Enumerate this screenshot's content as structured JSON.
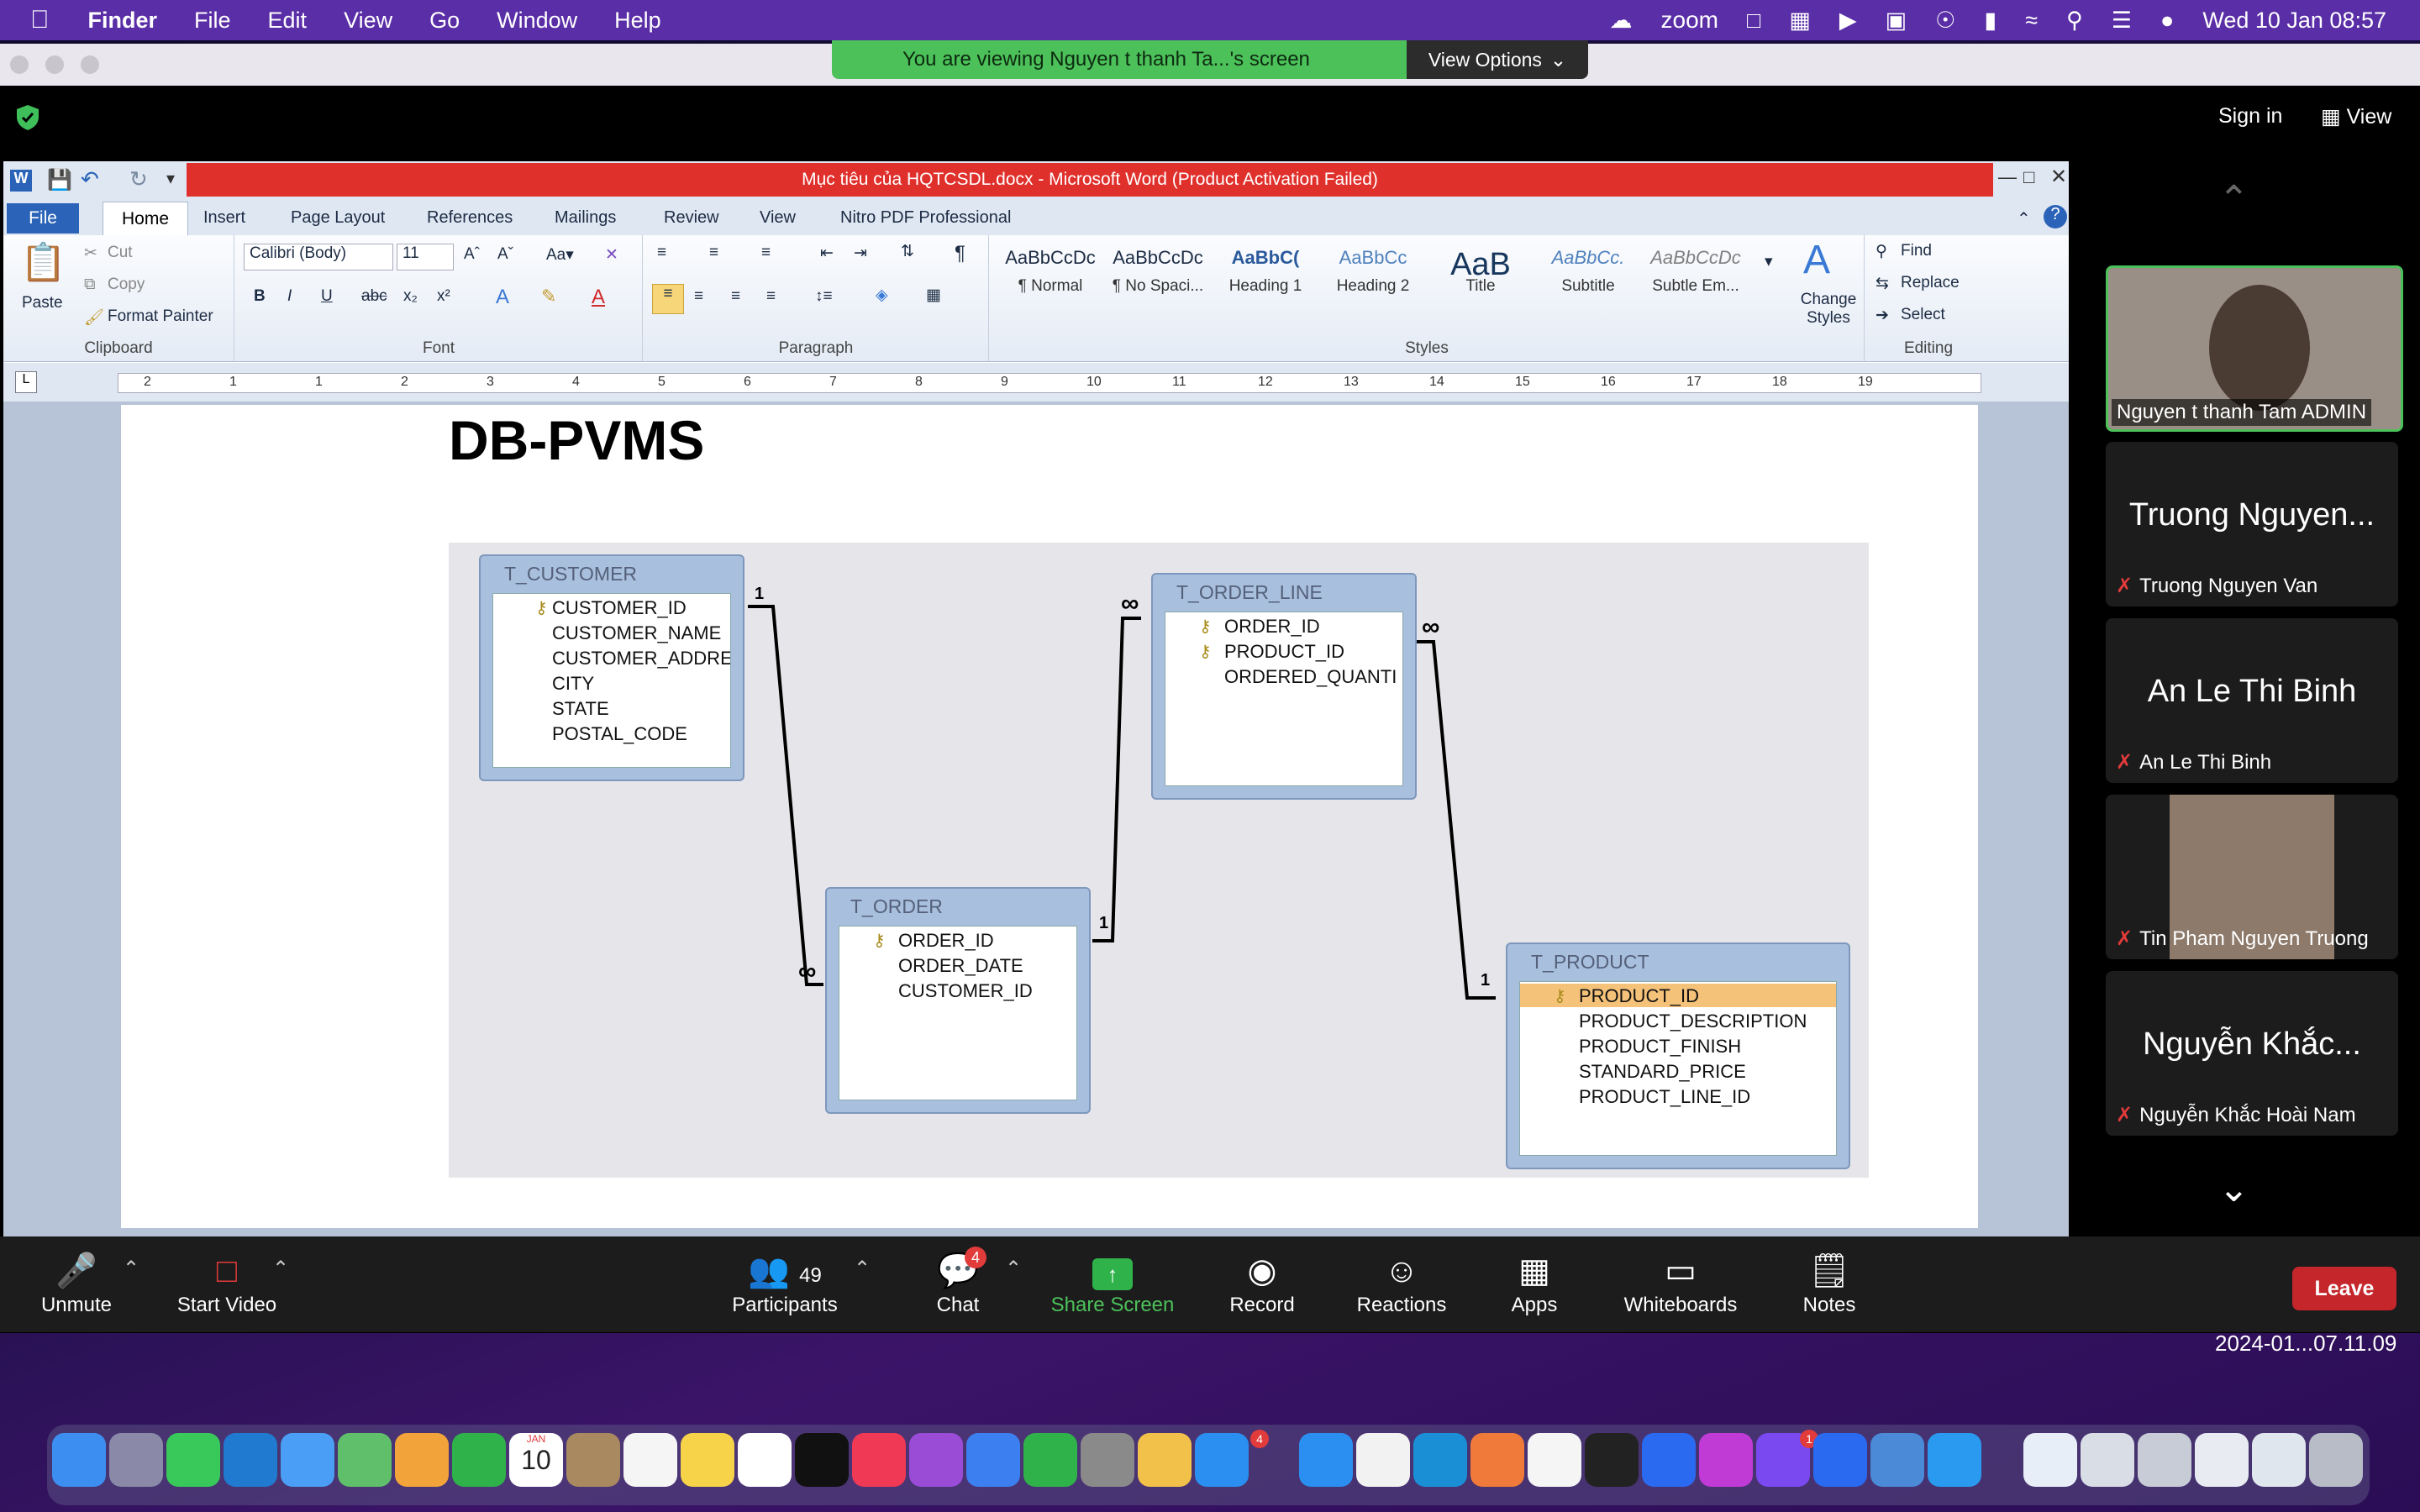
{
  "menubar": {
    "app": "Finder",
    "items": [
      "File",
      "Edit",
      "View",
      "Go",
      "Window",
      "Help"
    ],
    "zoom": "zoom",
    "datetime": "Wed 10 Jan  08:57"
  },
  "zoom": {
    "viewing": "You are viewing Nguyen t thanh Ta...'s screen",
    "view_options": "View Options",
    "sign_in": "Sign in",
    "view": "View",
    "timestamp": "2024-01...07.11.09",
    "participants": [
      {
        "big": "",
        "name": "Nguyen t thanh Tam ADMIN"
      },
      {
        "big": "Truong Nguyen...",
        "name": "Truong Nguyen Van"
      },
      {
        "big": "An Le Thi Binh",
        "name": "An Le Thi Binh"
      },
      {
        "big": "",
        "name": "Tin Pham Nguyen Truong"
      },
      {
        "big": "Nguyễn Khắc...",
        "name": "Nguyễn Khắc Hoài Nam"
      }
    ],
    "toolbar": {
      "unmute": "Unmute",
      "start_video": "Start Video",
      "participants": "Participants",
      "participants_count": "49",
      "chat": "Chat",
      "chat_badge": "4",
      "share": "Share Screen",
      "record": "Record",
      "reactions": "Reactions",
      "apps": "Apps",
      "whiteboards": "Whiteboards",
      "notes": "Notes",
      "leave": "Leave"
    }
  },
  "word": {
    "title": "Mục tiêu của HQTCSDL.docx  -  Microsoft Word (Product Activation Failed)",
    "tabs": [
      "File",
      "Home",
      "Insert",
      "Page Layout",
      "References",
      "Mailings",
      "Review",
      "View",
      "Nitro PDF Professional"
    ],
    "clipboard": {
      "paste": "Paste",
      "cut": "Cut",
      "copy": "Copy",
      "format_painter": "Format Painter",
      "label": "Clipboard"
    },
    "font": {
      "name": "Calibri (Body)",
      "size": "11",
      "label": "Font"
    },
    "paragraph_label": "Paragraph",
    "styles": [
      {
        "preview": "AaBbCcDc",
        "name": "¶ Normal"
      },
      {
        "preview": "AaBbCcDc",
        "name": "¶ No Spaci..."
      },
      {
        "preview": "AaBbC(",
        "name": "Heading 1"
      },
      {
        "preview": "AaBbCc",
        "name": "Heading 2"
      },
      {
        "preview": "AaB",
        "name": "Title"
      },
      {
        "preview": "AaBbCc.",
        "name": "Subtitle"
      },
      {
        "preview": "AaBbCcDc",
        "name": "Subtle Em..."
      }
    ],
    "styles_label": "Styles",
    "change_styles": "Change Styles",
    "editing": {
      "find": "Find",
      "replace": "Replace",
      "select": "Select",
      "label": "Editing"
    },
    "ruler": [
      "2",
      "1",
      "1",
      "2",
      "3",
      "4",
      "5",
      "6",
      "7",
      "8",
      "9",
      "10",
      "11",
      "12",
      "13",
      "14",
      "15",
      "16",
      "17",
      "18",
      "19"
    ],
    "doc_title": "DB-PVMS",
    "tables": {
      "customer": {
        "name": "T_CUSTOMER",
        "fields": [
          "CUSTOMER_ID",
          "CUSTOMER_NAME",
          "CUSTOMER_ADDRE",
          "CITY",
          "STATE",
          "POSTAL_CODE"
        ]
      },
      "order_line": {
        "name": "T_ORDER_LINE",
        "fields": [
          "ORDER_ID",
          "PRODUCT_ID",
          "ORDERED_QUANTI"
        ]
      },
      "order": {
        "name": "T_ORDER",
        "fields": [
          "ORDER_ID",
          "ORDER_DATE",
          "CUSTOMER_ID"
        ]
      },
      "product": {
        "name": "T_PRODUCT",
        "fields": [
          "PRODUCT_ID",
          "PRODUCT_DESCRIPTION",
          "PRODUCT_FINISH",
          "STANDARD_PRICE",
          "PRODUCT_LINE_ID"
        ]
      }
    },
    "rel_one": "1",
    "rel_many": "∞"
  },
  "dock_badges": {
    "appstore": "4",
    "messenger": "1"
  },
  "dock_calendar": {
    "month": "JAN",
    "day": "10"
  },
  "colors": {
    "accent_green": "#4cc15a",
    "leave_red": "#c4262c",
    "word_title_red": "#e0302c"
  }
}
